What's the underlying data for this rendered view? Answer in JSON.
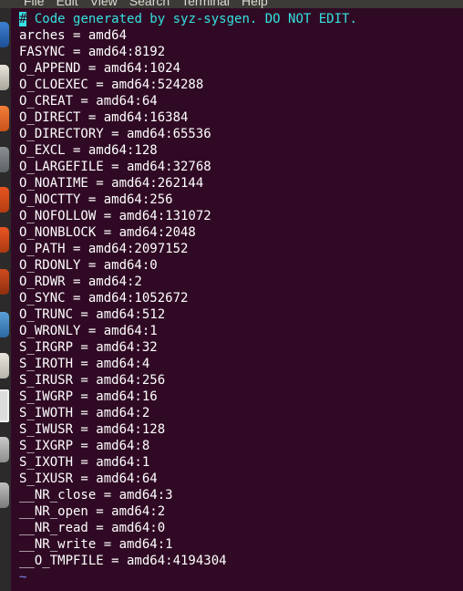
{
  "menubar": {
    "items": [
      "File",
      "Edit",
      "View",
      "Search",
      "Terminal",
      "Help"
    ]
  },
  "launcher": {
    "icons": [
      "files-icon",
      "document-viewer-icon",
      "firefox-icon",
      "system-settings-icon",
      "ubuntu-software-icon",
      "ubuntu-icon",
      "app-icon",
      "text-editor-icon",
      "libreoffice-icon",
      "terminal-icon",
      "disk-icon",
      "trash-icon"
    ]
  },
  "editor": {
    "cursor_char": "#",
    "comment": " Code generated by syz-sysgen. DO NOT EDIT.",
    "lines": [
      "arches = amd64",
      "FASYNC = amd64:8192",
      "O_APPEND = amd64:1024",
      "O_CLOEXEC = amd64:524288",
      "O_CREAT = amd64:64",
      "O_DIRECT = amd64:16384",
      "O_DIRECTORY = amd64:65536",
      "O_EXCL = amd64:128",
      "O_LARGEFILE = amd64:32768",
      "O_NOATIME = amd64:262144",
      "O_NOCTTY = amd64:256",
      "O_NOFOLLOW = amd64:131072",
      "O_NONBLOCK = amd64:2048",
      "O_PATH = amd64:2097152",
      "O_RDONLY = amd64:0",
      "O_RDWR = amd64:2",
      "O_SYNC = amd64:1052672",
      "O_TRUNC = amd64:512",
      "O_WRONLY = amd64:1",
      "S_IRGRP = amd64:32",
      "S_IROTH = amd64:4",
      "S_IRUSR = amd64:256",
      "S_IWGRP = amd64:16",
      "S_IWOTH = amd64:2",
      "S_IWUSR = amd64:128",
      "S_IXGRP = amd64:8",
      "S_IXOTH = amd64:1",
      "S_IXUSR = amd64:64",
      "__NR_close = amd64:3",
      "__NR_open = amd64:2",
      "__NR_read = amd64:0",
      "__NR_write = amd64:1",
      "__O_TMPFILE = amd64:4194304"
    ],
    "tilde": "~"
  },
  "colors": {
    "background": "#300a24",
    "text": "#ffffff",
    "comment": "#34e2e2",
    "tilde": "#7b8cf0"
  }
}
